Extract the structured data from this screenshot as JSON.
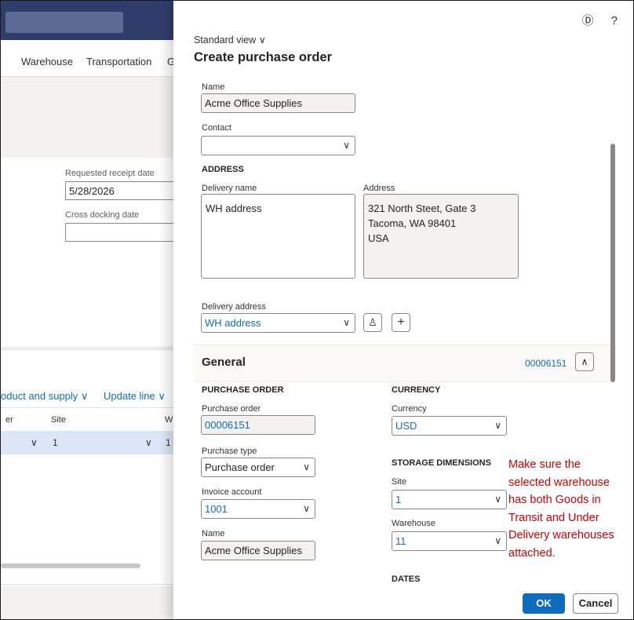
{
  "bg": {
    "tabs": [
      "Warehouse",
      "Transportation",
      "G"
    ],
    "requested_receipt_label": "Requested receipt date",
    "requested_receipt_value": "5/28/2026",
    "cross_docking_label": "Cross docking date",
    "product_supply": "oduct and supply ∨",
    "update_line": "Update line ∨",
    "col_partial": "er",
    "col_site": "Site",
    "col_w": "W",
    "row_site": "1",
    "row_w": "1"
  },
  "panel": {
    "view_label": "Standard view",
    "title": "Create purchase order"
  },
  "form": {
    "name_label": "Name",
    "name_value": "Acme Office Supplies",
    "contact_label": "Contact",
    "address_section": "ADDRESS",
    "delivery_name_label": "Delivery name",
    "delivery_name_value": "WH address",
    "address_label": "Address",
    "address_lines": [
      "321 North Steet, Gate 3",
      "Tacoma, WA 98401",
      "USA"
    ],
    "delivery_address_label": "Delivery address",
    "delivery_address_value": "WH address"
  },
  "general": {
    "title": "General",
    "summary": "00006151",
    "po_section": "PURCHASE ORDER",
    "po_label": "Purchase order",
    "po_value": "00006151",
    "type_label": "Purchase type",
    "type_value": "Purchase order",
    "invoice_label": "Invoice account",
    "invoice_value": "1001",
    "name_label": "Name",
    "name_value": "Acme Office Supplies",
    "currency_section": "CURRENCY",
    "currency_label": "Currency",
    "currency_value": "USD",
    "storage_section": "STORAGE DIMENSIONS",
    "site_label": "Site",
    "site_value": "1",
    "warehouse_label": "Warehouse",
    "warehouse_value": "11",
    "dates_section": "DATES"
  },
  "buttons": {
    "ok": "OK",
    "cancel": "Cancel"
  },
  "annotation": {
    "lines": [
      "Make sure the",
      "selected warehouse",
      "has both Goods in",
      "Transit and Under",
      "Delivery warehouses",
      "attached."
    ],
    "color": "#d10000"
  },
  "colors": {
    "accent": "#0f6cbd"
  }
}
